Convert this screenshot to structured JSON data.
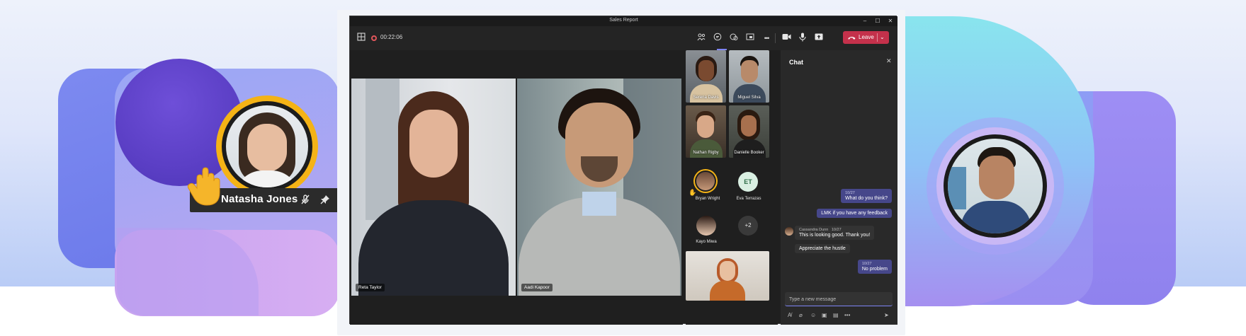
{
  "window": {
    "title": "Sales Report"
  },
  "toolbar": {
    "timer": "00:22:06",
    "leave_label": "Leave",
    "icons": [
      "grid-icon",
      "record-icon",
      "people-icon",
      "chat-icon",
      "react-icon",
      "share-tray-icon",
      "more-icon",
      "camera-icon",
      "mic-icon",
      "share-icon",
      "phone-icon",
      "chevron-down-icon"
    ]
  },
  "featured": {
    "name": "Natasha Jones",
    "icons": [
      "raise-hand-icon",
      "mic-off-icon",
      "pin-icon",
      "more-icon"
    ]
  },
  "stage": {
    "tiles": [
      {
        "name": "Reta Taylor"
      },
      {
        "name": "Aadi Kapoor"
      }
    ]
  },
  "gallery": {
    "video_tiles": [
      {
        "name": "Serena Davis"
      },
      {
        "name": "Miguel Silva"
      },
      {
        "name": "Nathan Rigby"
      },
      {
        "name": "Danielle Booker"
      }
    ],
    "avatars": [
      {
        "name": "Bryan Wright"
      },
      {
        "name": "Eva Terrazas",
        "initials": "ET"
      },
      {
        "name": "Kayo Miwa"
      },
      {
        "overflow": "+2"
      }
    ]
  },
  "chat": {
    "title": "Chat",
    "messages": [
      {
        "from": "me",
        "time": "10/27",
        "text": "What do you think?"
      },
      {
        "from": "me",
        "text": "LMK if you have any feedback"
      },
      {
        "from": "Cassandra Dunn",
        "time": "10/27",
        "text": "This is looking good. Thank you!"
      },
      {
        "from": "Cassandra Dunn",
        "text": "Appreciate the hustle"
      },
      {
        "from": "me",
        "time": "10/27",
        "text": "No problem"
      }
    ],
    "compose_placeholder": "Type a new message"
  },
  "colors": {
    "leave": "#c4314b",
    "my_bubble": "#46478a",
    "accent": "#7f85f5",
    "hand_ring": "#f4b316"
  }
}
